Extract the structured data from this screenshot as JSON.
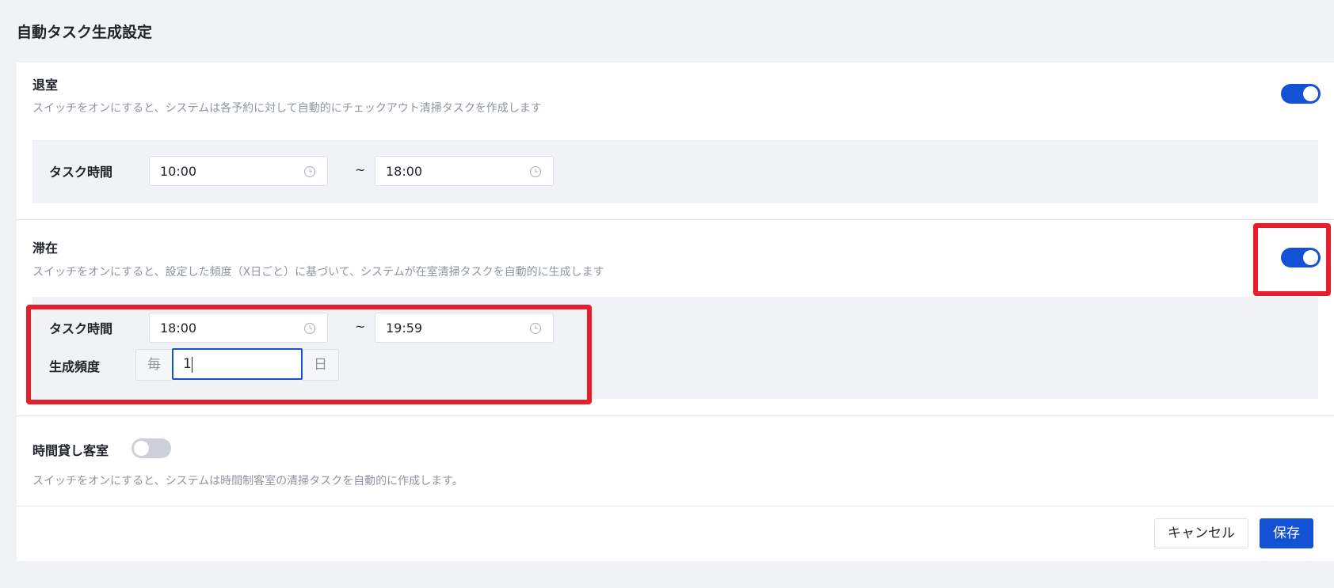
{
  "page": {
    "title": "自動タスク生成設定"
  },
  "checkout": {
    "title": "退室",
    "description": "スイッチをオンにすると、システムは各予約に対して自動的にチェックアウト清掃タスクを作成します",
    "enabled": true,
    "task_time_label": "タスク時間",
    "start_time": "10:00",
    "end_time": "18:00",
    "separator": "~"
  },
  "stay": {
    "title": "滞在",
    "description": "スイッチをオンにすると、設定した頻度（X日ごと）に基づいて、システムが在室清掃タスクを自動的に生成します",
    "enabled": true,
    "task_time_label": "タスク時間",
    "start_time": "18:00",
    "end_time": "19:59",
    "separator": "~",
    "frequency_label": "生成頻度",
    "frequency_prefix": "毎",
    "frequency_value": "1",
    "frequency_suffix": "日"
  },
  "hourly": {
    "title": "時間貸し客室",
    "description": "スイッチをオンにすると、システムは時間制客室の清掃タスクを自動的に作成します。",
    "enabled": false
  },
  "footer": {
    "cancel_label": "キャンセル",
    "save_label": "保存"
  },
  "colors": {
    "accent": "#1352d4",
    "highlight": "#e81c2b",
    "background": "#f1f2f6"
  }
}
